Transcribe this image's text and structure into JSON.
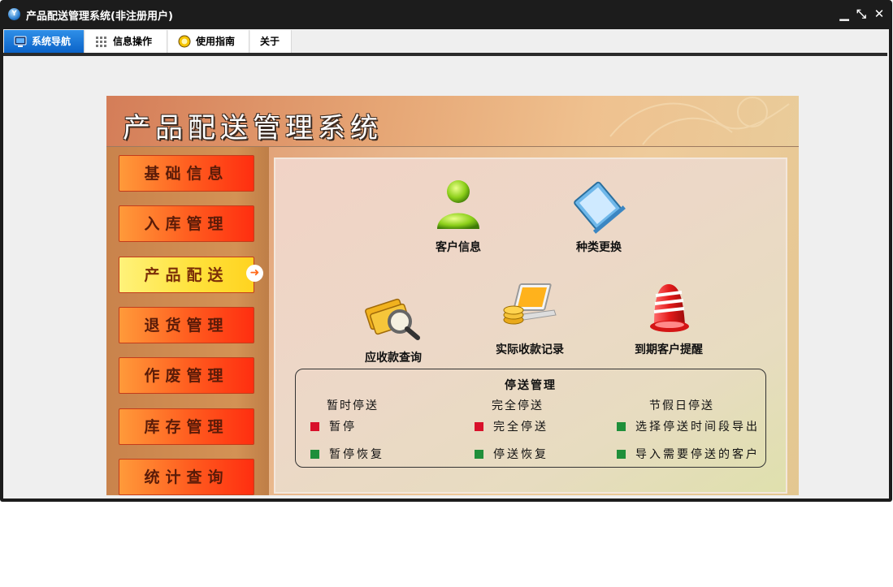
{
  "window": {
    "title": "产品配送管理系统(非注册用户)",
    "controls": {
      "minimize": "▁",
      "restore": "⤡",
      "close": "✕"
    }
  },
  "menu": {
    "tabs": [
      {
        "label": "系统导航",
        "icon": "monitor-icon",
        "active": true
      },
      {
        "label": "信息操作",
        "icon": "grid-icon",
        "active": false
      },
      {
        "label": "使用指南",
        "icon": "guide-icon",
        "active": false
      },
      {
        "label": "关于",
        "icon": "",
        "active": false
      }
    ]
  },
  "banner": {
    "title": "产品配送管理系统"
  },
  "nav": {
    "items": [
      {
        "label": "基础信息",
        "active": false
      },
      {
        "label": "入库管理",
        "active": false
      },
      {
        "label": "产品配送",
        "active": true
      },
      {
        "label": "退货管理",
        "active": false
      },
      {
        "label": "作废管理",
        "active": false
      },
      {
        "label": "库存管理",
        "active": false
      },
      {
        "label": "统计查询",
        "active": false
      }
    ]
  },
  "features": [
    {
      "label": "客户信息",
      "icon": "customer-person-icon"
    },
    {
      "label": "种类更换",
      "icon": "category-change-icon"
    },
    {
      "label": "应收款查询",
      "icon": "receivable-search-icon"
    },
    {
      "label": "实际收款记录",
      "icon": "payment-record-icon"
    },
    {
      "label": "到期客户提醒",
      "icon": "alarm-bell-icon"
    }
  ],
  "stop_delivery": {
    "title": "停送管理",
    "columns": [
      {
        "header": "暂时停送",
        "options": [
          {
            "label": "暂停",
            "color": "#d8102a"
          },
          {
            "label": "暂停恢复",
            "color": "#1f8f3a"
          }
        ]
      },
      {
        "header": "完全停送",
        "options": [
          {
            "label": "完全停送",
            "color": "#d8102a"
          },
          {
            "label": "停送恢复",
            "color": "#1f8f3a"
          }
        ]
      },
      {
        "header": "节假日停送",
        "options": [
          {
            "label": "选择停送时间段导出",
            "color": "#1f8f3a"
          },
          {
            "label": "导入需要停送的客户",
            "color": "#1f8f3a"
          }
        ]
      }
    ]
  }
}
